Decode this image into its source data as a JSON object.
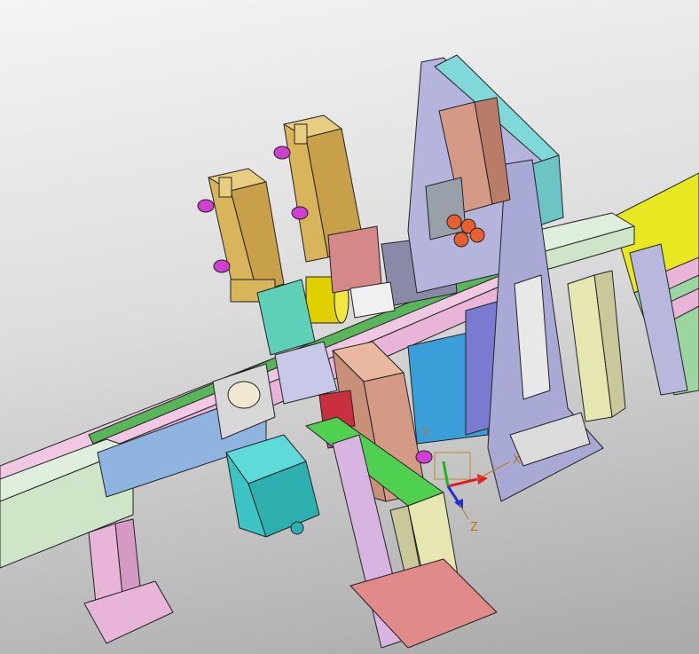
{
  "viewport": {
    "background_top": "#f4f4f4",
    "background_bottom": "#a9a9a9"
  },
  "triad": {
    "x_label": "X",
    "y_label": "Y",
    "z_label": "Z",
    "x_color": "#e02020",
    "y_color": "#20b020",
    "z_color": "#2030d0",
    "label_color": "#b8781a"
  },
  "colors": {
    "rail_pink": "#e8b4d8",
    "rail_green": "#cfe5c8",
    "frame_lavender": "#a9a9d6",
    "frame_cyan": "#7fd9d9",
    "gripper_gold": "#d8b45a",
    "valve_magenta": "#d040d0",
    "slide_salmon": "#d49a86",
    "plate_teal": "#5fd0b8",
    "motor_teal": "#3cc4c4",
    "base_red": "#e08a8a",
    "conveyor_yellow": "#e8e820",
    "column_yellow": "#e6e6b0",
    "block_blue": "#3a9ed8",
    "block_slate": "#8a8aa8"
  }
}
